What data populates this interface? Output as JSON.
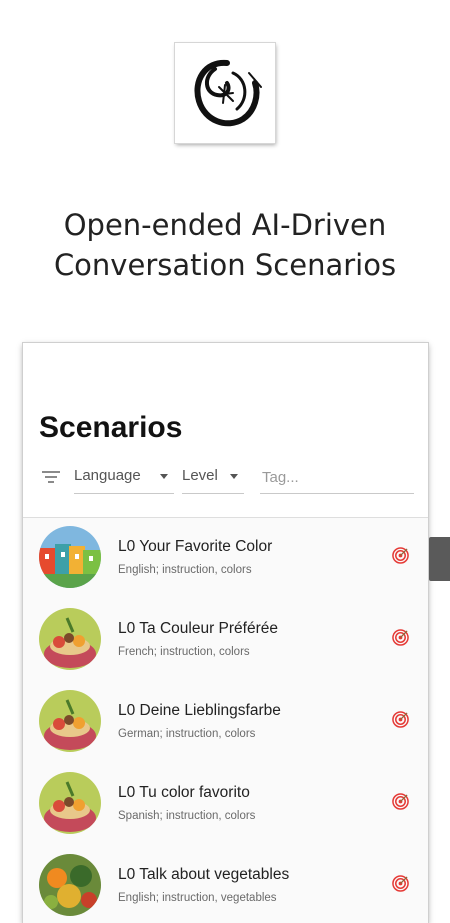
{
  "headline": {
    "line1": "Open-ended AI-Driven",
    "line2": "Conversation Scenarios"
  },
  "card": {
    "title": "Scenarios",
    "filters": {
      "language_label": "Language",
      "level_label": "Level",
      "tag_placeholder": "Tag..."
    }
  },
  "scenarios": [
    {
      "title": "L0 Your Favorite Color",
      "subtitle": "English; instruction, colors",
      "image": "colorful-houses"
    },
    {
      "title": "L0 Ta Couleur Préférée",
      "subtitle": "French; instruction, colors",
      "image": "food-basket"
    },
    {
      "title": "L0 Deine Lieblingsfarbe",
      "subtitle": "German; instruction, colors",
      "image": "food-basket"
    },
    {
      "title": "L0 Tu color favorito",
      "subtitle": "Spanish; instruction, colors",
      "image": "food-basket"
    },
    {
      "title": "L0 Talk about vegetables",
      "subtitle": "English; instruction, vegetables",
      "image": "vegetables"
    }
  ],
  "icons": {
    "logo": "app-logo-icon",
    "filter": "filter-icon",
    "target": "target-icon"
  },
  "colors": {
    "target_red": "#e53935",
    "scroll_tab": "#5a5a5a"
  }
}
